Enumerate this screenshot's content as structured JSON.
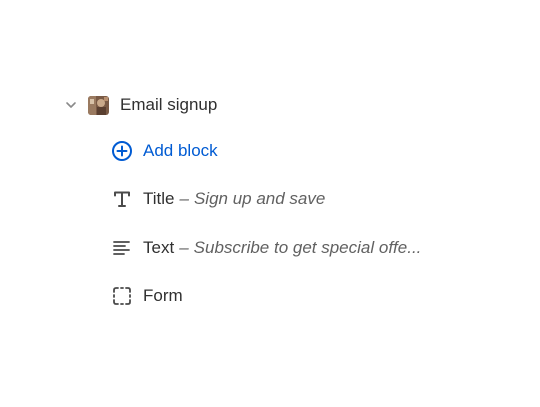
{
  "section": {
    "title": "Email signup",
    "expanded": true
  },
  "add_block": {
    "label": "Add block",
    "icon": "plus-circle-icon",
    "color": "#005bd3"
  },
  "blocks": [
    {
      "label": "Title",
      "separator": "–",
      "description": "Sign up and save",
      "icon": "title-text-icon"
    },
    {
      "label": "Text",
      "separator": "–",
      "description": "Subscribe to get special offe...",
      "icon": "paragraph-text-icon"
    },
    {
      "label": "Form",
      "separator": "",
      "description": "",
      "icon": "form-frame-icon"
    }
  ]
}
